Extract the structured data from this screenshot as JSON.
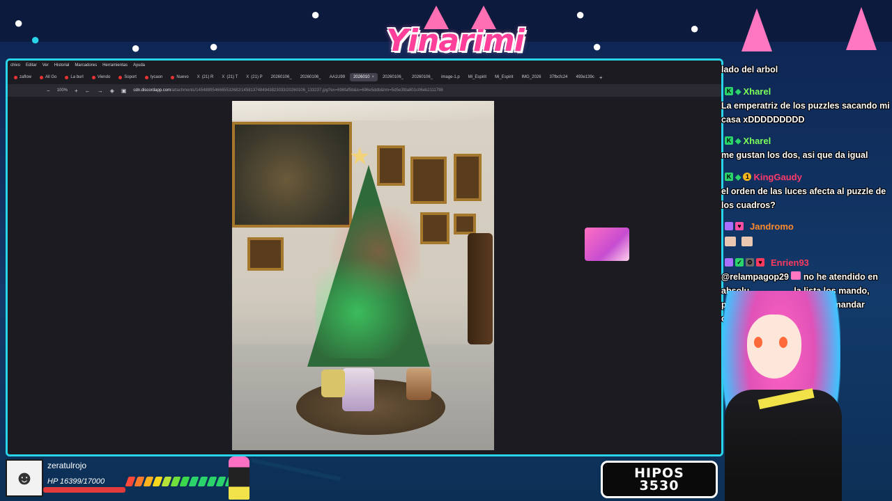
{
  "overlay": {
    "logo_text": "Yinarimi",
    "colors": {
      "accent_cyan": "#2ad4e8",
      "accent_pink": "#ff3f9a",
      "bg_navy": "#0e2350"
    }
  },
  "browser": {
    "menu": [
      "chivo",
      "Editar",
      "Ver",
      "Historial",
      "Marcadores",
      "Herramientas",
      "Ayuda"
    ],
    "tabs": [
      {
        "label": "zaflow",
        "active": false
      },
      {
        "label": "All Go",
        "active": false
      },
      {
        "label": "La burl",
        "active": false
      },
      {
        "label": "Viendo",
        "active": false
      },
      {
        "label": "Soport",
        "active": false
      },
      {
        "label": "lycaon",
        "active": false
      },
      {
        "label": "Nuevo",
        "active": false
      },
      {
        "label": "(21) R",
        "active": false
      },
      {
        "label": "(21) T",
        "active": false
      },
      {
        "label": "(21) P",
        "active": false
      },
      {
        "label": "20260106_",
        "active": false
      },
      {
        "label": "20260106_",
        "active": false
      },
      {
        "label": "AA1U99",
        "active": false
      },
      {
        "label": "2026010",
        "active": true
      },
      {
        "label": "20260106_",
        "active": false
      },
      {
        "label": "20260106_",
        "active": false
      },
      {
        "label": "image-1.p",
        "active": false
      },
      {
        "label": "Mi_Espirit",
        "active": false
      },
      {
        "label": "Mi_Espirit",
        "active": false
      },
      {
        "label": "IMG_2026",
        "active": false
      },
      {
        "label": "37fbcfc24",
        "active": false
      },
      {
        "label": "493e139c",
        "active": false
      }
    ],
    "zoom": "100%",
    "url_domain": "cdn.discordapp.com",
    "url_rest": "/attachments/1454889546665532682/1458137484943823033/20260106_133237.jpg?ex=696faf5b&is=696e5ddb&hm=5d5e3fda801c06eb2111798"
  },
  "chat": {
    "messages": [
      {
        "user": "",
        "text": "lado del arbol",
        "color": "#ffffff"
      },
      {
        "user": "Xharel",
        "text": "La emperatriz de los puzzles sacando mi casa xDDDDDDDDD",
        "color": "#7cff5a"
      },
      {
        "user": "Xharel",
        "text": "me gustan los dos, asi que da igual",
        "color": "#7cff5a"
      },
      {
        "user": "KingGaudy",
        "text": "el orden de las luces afecta al puzzle de los cuadros?",
        "color": "#ff3a6b"
      },
      {
        "user": "Jandromo",
        "text": "",
        "color": "#ff8a2a"
      },
      {
        "user": "Enrien93",
        "text": "@relampagop29 no he atendido en absoluto, si me da la lista los mando, pero creo que me toca que mandar cuantos",
        "color": "#ff3a5e"
      }
    ],
    "line1": "lado del arbol",
    "m2_line1": "La emperatriz de los puzzles sacando mi",
    "m2_line2": "casa xDDDDDDDDD",
    "m3_line1": "me gustan los dos, asi que da igual",
    "m4_line1": "el orden de las luces afecta al puzzle de",
    "m4_line2": "los cuadros?",
    "m6_line1": "@relampagop29",
    "m6_line1b": "no he atendido en",
    "m6_line2": "absolu",
    "m6_line2b": "la lista los mando,",
    "m6_line3": "pe",
    "m6_line3b": "ue mandar",
    "m6_line4": "cuan"
  },
  "player": {
    "name": "zeratulrojo",
    "hp_text": "HP 16399/17000",
    "hp_fraction": 0.965,
    "avatar_icon": "soldier-avatar-icon"
  },
  "counter": {
    "label": "HIPOS",
    "value": "3530"
  }
}
